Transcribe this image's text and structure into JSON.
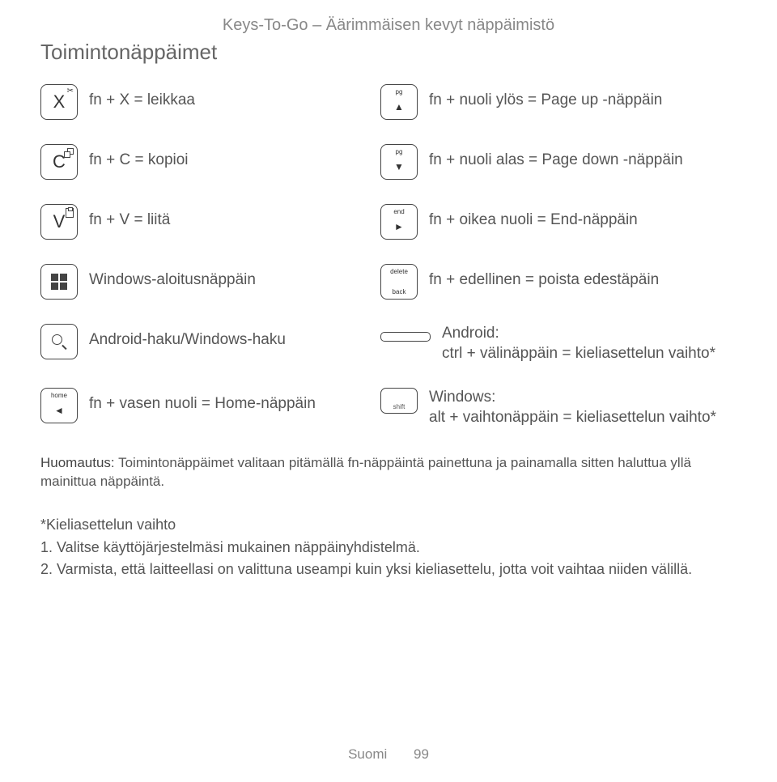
{
  "header_title": "Keys-To-Go – Äärimmäisen kevyt näppäimistö",
  "section_title": "Toimintonäppäimet",
  "keys": {
    "x": {
      "letter": "X",
      "desc": "fn + X = leikkaa"
    },
    "c": {
      "letter": "C",
      "desc": "fn + C = kopioi"
    },
    "v": {
      "letter": "V",
      "desc": "fn + V = liitä"
    },
    "win": {
      "desc": "Windows-aloitusnäppäin"
    },
    "search": {
      "desc": "Android-haku/Windows-haku"
    },
    "home": {
      "tiny": "home",
      "arrow": "◄",
      "desc": "fn + vasen nuoli = Home-näppäin"
    },
    "pgup": {
      "tiny": "pg",
      "arrow": "▲",
      "desc": "fn + nuoli ylös = Page up -näppäin"
    },
    "pgdn": {
      "tiny": "pg",
      "arrow": "▼",
      "desc": "fn + nuoli alas = Page down -näppäin"
    },
    "end": {
      "tiny": "end",
      "arrow": "►",
      "desc": "fn + oikea nuoli = End-näppäin"
    },
    "delback": {
      "top": "delete",
      "bottom": "back",
      "desc": "fn + edellinen = poista edestäpäin"
    },
    "space": {
      "desc": "Android:\nctrl + välinäppäin = kieliasettelun vaihto*"
    },
    "shift": {
      "label": "shift",
      "desc": "Windows:\nalt + vaihtonäppäin = kieliasettelun vaihto*"
    }
  },
  "note_label": "Huomautus:",
  "note_text": " Toimintonäppäimet valitaan pitämällä fn-näppäintä painettuna ja painamalla sitten haluttua yllä mainittua näppäintä.",
  "sub_title": "*Kieliasettelun vaihto",
  "step1": "1.  Valitse käyttöjärjestelmäsi mukainen näppäinyhdistelmä.",
  "step2": "2.  Varmista, että laitteellasi on valittuna useampi kuin yksi kieliasettelu, jotta voit vaihtaa niiden välillä.",
  "footer_lang": "Suomi",
  "footer_page": "99"
}
